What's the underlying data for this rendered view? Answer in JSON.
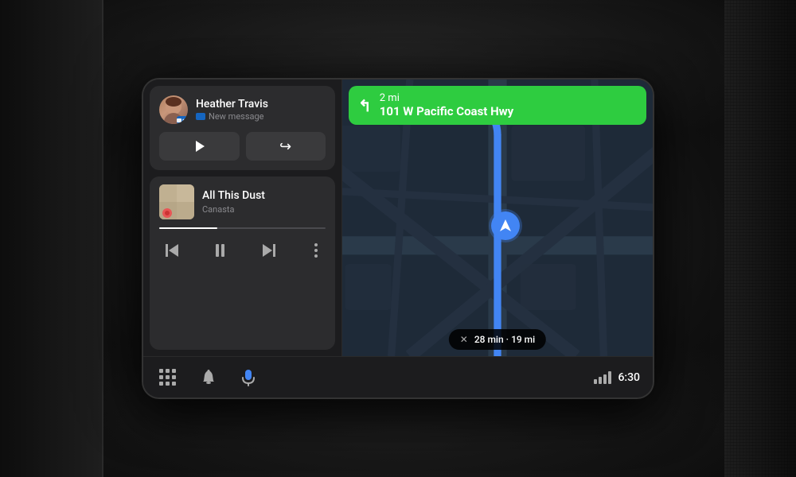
{
  "dashboard": {
    "background_color": "#1c1c1e"
  },
  "message_card": {
    "contact_name": "Heather Travis",
    "subtitle": "New message",
    "play_label": "Play",
    "reply_label": "Reply"
  },
  "music_card": {
    "track_name": "All This Dust",
    "artist_name": "Canasta",
    "progress_percent": 35
  },
  "navigation": {
    "turn_direction": "↰",
    "distance": "2 mi",
    "street": "101 W Pacific Coast Hwy",
    "eta_time": "28 min",
    "eta_distance": "19 mi",
    "accent_color": "#2ecc40"
  },
  "bottom_bar": {
    "time": "6:30"
  },
  "icons": {
    "grid": "grid-icon",
    "bell": "bell-icon",
    "mic": "mic-icon",
    "signal": "signal-icon",
    "battery": "battery-icon"
  }
}
